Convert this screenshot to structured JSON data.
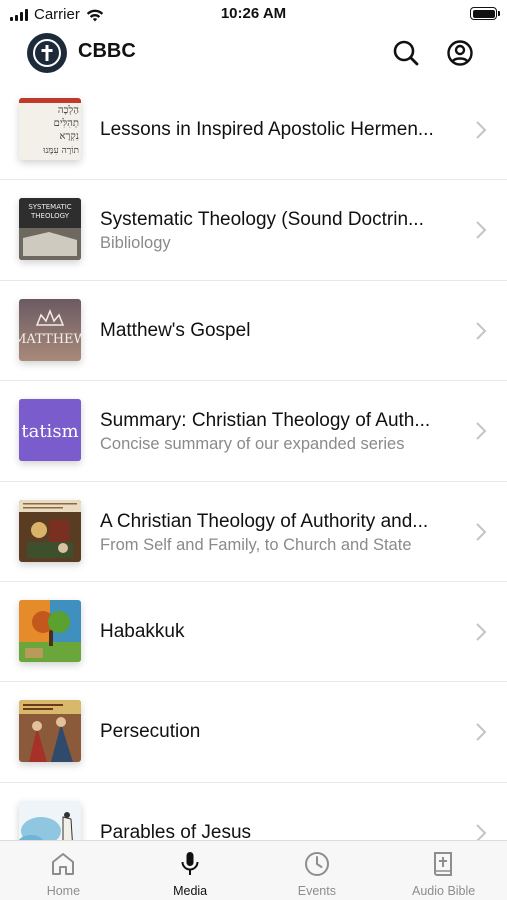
{
  "status_bar": {
    "carrier": "Carrier",
    "time": "10:26 AM",
    "battery_level": 1.0
  },
  "header": {
    "title": "CBBC",
    "logo_icon": "cross-logo-icon",
    "search_icon": "search-icon",
    "account_icon": "account-circle-icon"
  },
  "media": {
    "items": [
      {
        "title": "Lessons in Inspired Apostolic Hermen...",
        "subtitle": "",
        "thumb": "hebrew-text"
      },
      {
        "title": "Systematic Theology (Sound Doctrin...",
        "subtitle": "Bibliology",
        "thumb": "book-cover"
      },
      {
        "title": "Matthew's Gospel",
        "subtitle": "",
        "thumb": "crown-matthew"
      },
      {
        "title": "Summary: Christian Theology of Auth...",
        "subtitle": "Concise summary of our expanded series",
        "thumb": "purple-tatism"
      },
      {
        "title": "A Christian Theology of Authority and...",
        "subtitle": "From Self and Family, to Church and State",
        "thumb": "painting"
      },
      {
        "title": "Habakkuk",
        "subtitle": "",
        "thumb": "tree"
      },
      {
        "title": "Persecution",
        "subtitle": "",
        "thumb": "painting-red"
      },
      {
        "title": "Parables of Jesus",
        "subtitle": "",
        "thumb": "watercolor"
      }
    ],
    "thumb_texts": {
      "hebrew_lines": [
        "הַלְכָה",
        "תְהִלִּים",
        "נִקְרָא",
        "תוֹרָה עִמָּנוּ"
      ],
      "systematic": [
        "SYSTEMATIC",
        "THEOLOGY"
      ],
      "matthew": "MATTHEW",
      "tatism": "tatism"
    }
  },
  "tab_bar": {
    "tabs": [
      {
        "label": "Home",
        "icon": "home-icon",
        "active": false
      },
      {
        "label": "Media",
        "icon": "microphone-icon",
        "active": true
      },
      {
        "label": "Events",
        "icon": "clock-icon",
        "active": false
      },
      {
        "label": "Audio Bible",
        "icon": "bible-book-icon",
        "active": false
      }
    ]
  },
  "colors": {
    "accent": "#111111",
    "inactive_tab": "#8e8e8e",
    "subtitle": "#8a8a8a",
    "logo_bg": "#1d2a3a",
    "tatism_bg": "#7b5ccc"
  }
}
